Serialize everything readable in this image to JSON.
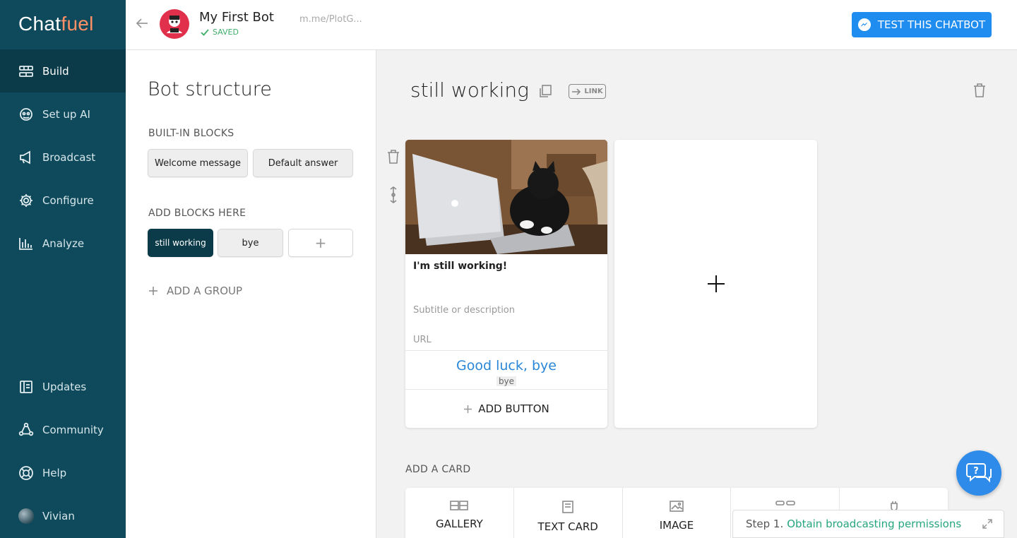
{
  "sidebar": {
    "logo_main": "Chat",
    "logo_accent": "fuel",
    "items": [
      {
        "label": "Build"
      },
      {
        "label": "Set up AI"
      },
      {
        "label": "Broadcast"
      },
      {
        "label": "Configure"
      },
      {
        "label": "Analyze"
      }
    ],
    "bottom_items": [
      {
        "label": "Updates"
      },
      {
        "label": "Community"
      },
      {
        "label": "Help"
      },
      {
        "label": "Vivian"
      }
    ]
  },
  "header": {
    "bot_name": "My First Bot",
    "saved_label": "SAVED",
    "bot_link": "m.me/PlotG...",
    "test_button": "TEST THIS CHATBOT"
  },
  "structure": {
    "title": "Bot structure",
    "builtin_label": "BUILT-IN BLOCKS",
    "builtin_blocks": [
      "Welcome message",
      "Default answer"
    ],
    "add_blocks_label": "ADD BLOCKS HERE",
    "blocks": [
      "still working",
      "bye"
    ],
    "add_block_symbol": "+",
    "add_group_label": "ADD A GROUP"
  },
  "block": {
    "title": "still working",
    "link_label": "LINK",
    "card": {
      "title": "I'm still working!",
      "subtitle_placeholder": "Subtitle or description",
      "url_placeholder": "URL",
      "button_label": "Good luck, bye",
      "button_target": "bye",
      "add_button_label": "ADD BUTTON"
    },
    "add_card_label": "ADD A CARD",
    "card_types": [
      "GALLERY",
      "TEXT CARD",
      "IMAGE",
      "",
      ""
    ]
  },
  "step_bar": {
    "prefix": "Step 1.",
    "highlight": "Obtain broadcasting permissions"
  },
  "colors": {
    "sidebar_bg": "#0e4a5b",
    "accent_blue": "#1f8cf0",
    "saved_green": "#3fae6a",
    "step_green": "#26a57f",
    "logo_accent": "#ff8f66"
  }
}
